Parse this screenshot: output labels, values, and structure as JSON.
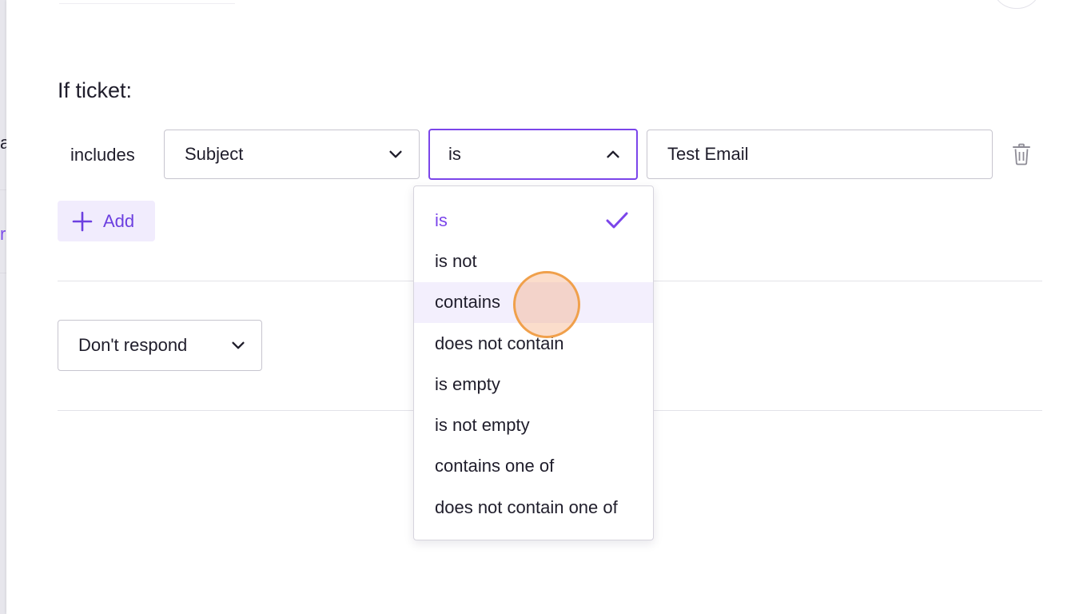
{
  "background": {
    "fragment_a": "a",
    "fragment_r": "r"
  },
  "rule": {
    "heading": "If ticket:",
    "condition_label": "includes",
    "field_select": {
      "value": "Subject"
    },
    "operator_select": {
      "value": "is",
      "open": true
    },
    "value_input": {
      "value": "Test Email"
    },
    "add_button": {
      "label": "Add"
    }
  },
  "operator_options": [
    {
      "label": "is",
      "selected": true
    },
    {
      "label": "is not",
      "selected": false
    },
    {
      "label": "contains",
      "selected": false,
      "hovered": true
    },
    {
      "label": "does not contain",
      "selected": false
    },
    {
      "label": "is empty",
      "selected": false
    },
    {
      "label": "is not empty",
      "selected": false
    },
    {
      "label": "contains one of",
      "selected": false
    },
    {
      "label": "does not contain one of",
      "selected": false
    }
  ],
  "action_select": {
    "value": "Don't respond"
  },
  "colors": {
    "accent": "#7b45ea",
    "add_button_bg": "#f1ecfd",
    "hover_row_bg": "#f3effd",
    "cursor_ring": "#f0a04b"
  },
  "icons": {
    "field_chevron": "chevron-down-icon",
    "operator_chevron": "chevron-up-icon",
    "action_chevron": "chevron-down-icon",
    "delete": "trash-icon",
    "add": "plus-icon",
    "selected_mark": "check-icon"
  }
}
